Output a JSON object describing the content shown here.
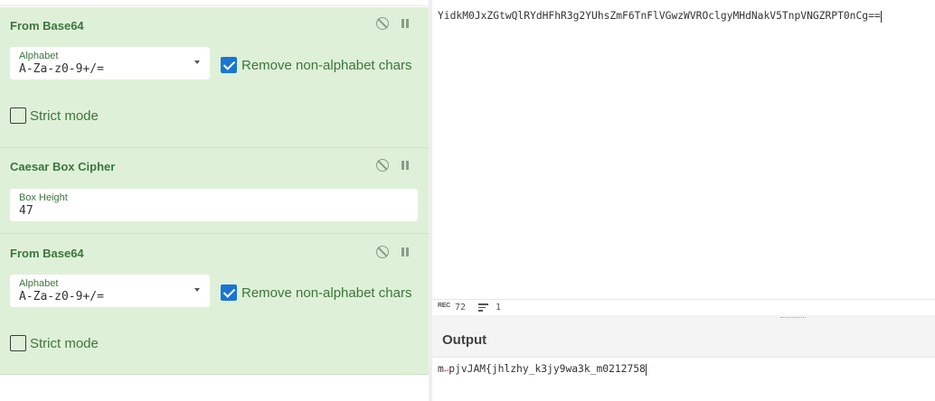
{
  "recipe": {
    "operations": [
      {
        "title": "From Base64",
        "alphabet_label": "Alphabet",
        "alphabet_value": "A-Za-z0-9+/=",
        "remove_label": "Remove non-alphabet chars",
        "remove_checked": true,
        "strict_label": "Strict mode",
        "strict_checked": false
      },
      {
        "title": "Caesar Box Cipher",
        "box_height_label": "Box Height",
        "box_height_value": "47"
      },
      {
        "title": "From Base64",
        "alphabet_label": "Alphabet",
        "alphabet_value": "A-Za-z0-9+/=",
        "remove_label": "Remove non-alphabet chars",
        "remove_checked": true,
        "strict_label": "Strict mode",
        "strict_checked": false
      }
    ]
  },
  "input": {
    "text": "YidkM0JxZGtwQlRYdHFhR3g2YUhsZmF6TnFlVGwzWVROclgyMHdNakV5TnpVNGZRPT0nCg=="
  },
  "status": {
    "length": "72",
    "lines": "1"
  },
  "output": {
    "title": "Output",
    "prefix": "m",
    "special_char": "↵",
    "text": "pjvJAM{jhlzhy_k3jy9wa3k_m0212758"
  },
  "icons": {
    "disable": "disable-icon",
    "pause": "pause-icon",
    "dropdown": "chevron-down-icon"
  },
  "colors": {
    "op_background": "#dff0d8",
    "op_title": "#3c763d",
    "checkbox_checked": "#1976d2"
  }
}
